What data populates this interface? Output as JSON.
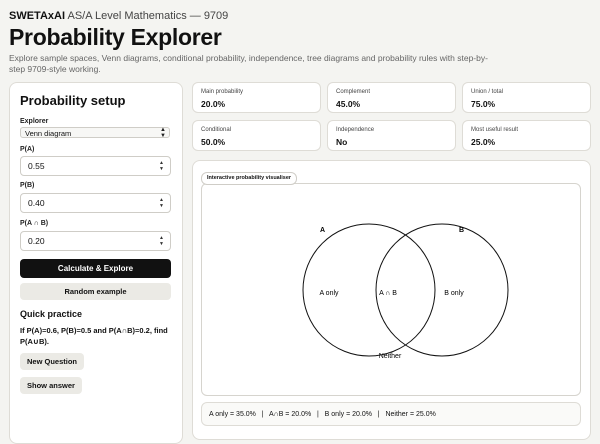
{
  "header": {
    "brand": "SWETAxAI",
    "course": "AS/A Level Mathematics — 9709",
    "title": "Probability Explorer",
    "subtitle": "Explore sample spaces, Venn diagrams, conditional probability, independence, tree diagrams and probability rules with step-by-step 9709-style working."
  },
  "setup": {
    "heading": "Probability setup",
    "explorer_label": "Explorer",
    "explorer_value": "Venn diagram",
    "pa_label": "P(A)",
    "pa_value": "0.55",
    "pb_label": "P(B)",
    "pb_value": "0.40",
    "pab_label": "P(A ∩ B)",
    "pab_value": "0.20",
    "calculate_label": "Calculate & Explore",
    "random_label": "Random example",
    "practice_heading": "Quick practice",
    "practice_text": "If P(A)=0.6, P(B)=0.5 and P(A∩B)=0.2, find P(A∪B).",
    "new_question_label": "New Question",
    "show_answer_label": "Show answer"
  },
  "stats": [
    {
      "label": "Main probability",
      "value": "20.0%"
    },
    {
      "label": "Complement",
      "value": "45.0%"
    },
    {
      "label": "Union / total",
      "value": "75.0%"
    },
    {
      "label": "Conditional",
      "value": "50.0%"
    },
    {
      "label": "Independence",
      "value": "No"
    },
    {
      "label": "Most useful result",
      "value": "25.0%"
    }
  ],
  "visualiser": {
    "tag": "Interactive probability visualiser",
    "set_a_label": "A",
    "set_b_label": "B",
    "a_only_label": "A only",
    "intersection_label": "A ∩ B",
    "b_only_label": "B only",
    "neither_label": "Neither",
    "summary": "A only = 35.0%   |   A∩B = 20.0%   |   B only = 20.0%   |   Neither = 25.0%"
  },
  "icons": {
    "select_arrows": "updown-chevron-icon",
    "stepper": "stepper-icon"
  },
  "colors": {
    "page_bg": "#f4f4f1",
    "primary_button": "#111111",
    "secondary_button": "#ebeae5"
  }
}
